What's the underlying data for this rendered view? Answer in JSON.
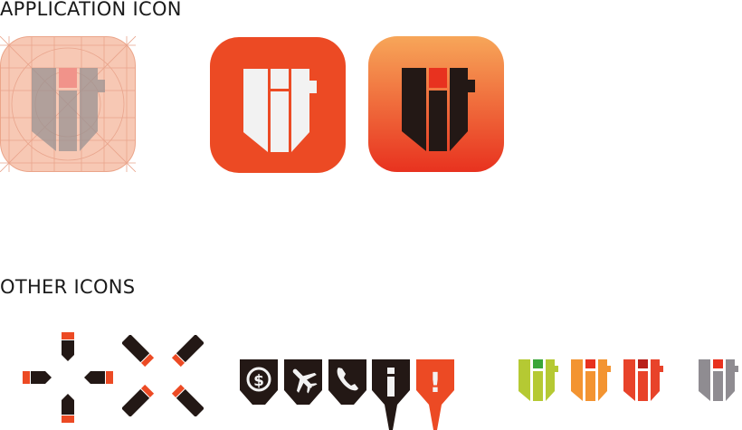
{
  "sections": {
    "application_icon_title": "APPLICATION ICON",
    "other_icons_title": "OTHER ICONS"
  },
  "colors": {
    "brand_orange": "#ec4a24",
    "gradient_top": "#f7a659",
    "gradient_bottom": "#e8321f",
    "dark": "#231815",
    "light": "#f2f2f2",
    "grid_bg": "#f6c4b0",
    "green": "#b5c933",
    "amber": "#f39431",
    "grey": "#8f8c91",
    "red_dot": "#e8321f"
  },
  "icons": {
    "application": [
      "grid-template-icon",
      "orange-app-icon",
      "gradient-app-icon"
    ],
    "other": [
      "move-cross-icon",
      "resize-x-icon",
      "dollar-badge-icon",
      "plane-badge-icon",
      "phone-badge-icon",
      "info-pin-icon",
      "alert-pin-icon",
      "green-logo-icon",
      "amber-logo-icon",
      "orange-logo-icon",
      "grey-logo-icon"
    ]
  },
  "glyphs": {
    "dollar": "$",
    "alert": "!"
  }
}
